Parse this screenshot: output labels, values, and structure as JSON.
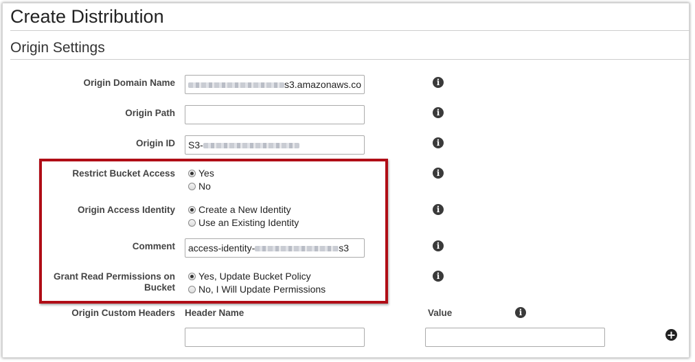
{
  "page": {
    "title": "Create Distribution"
  },
  "section": {
    "title": "Origin Settings"
  },
  "fields": {
    "origin_domain_name": {
      "label": "Origin Domain Name",
      "value_suffix": "s3.amazonaws.co"
    },
    "origin_path": {
      "label": "Origin Path",
      "value": ""
    },
    "origin_id": {
      "label": "Origin ID",
      "value_prefix": "S3-"
    },
    "restrict_bucket_access": {
      "label": "Restrict Bucket Access",
      "options": [
        {
          "label": "Yes",
          "checked": true
        },
        {
          "label": "No",
          "checked": false
        }
      ]
    },
    "origin_access_identity": {
      "label": "Origin Access Identity",
      "options": [
        {
          "label": "Create a New Identity",
          "checked": true
        },
        {
          "label": "Use an Existing Identity",
          "checked": false
        }
      ]
    },
    "comment": {
      "label": "Comment",
      "value_prefix": "access-identity-",
      "value_suffix": "s3"
    },
    "grant_read_permissions": {
      "label_line1": "Grant Read Permissions on",
      "label_line2": "Bucket",
      "options": [
        {
          "label": "Yes, Update Bucket Policy",
          "checked": true
        },
        {
          "label": "No, I Will Update Permissions",
          "checked": false
        }
      ]
    },
    "origin_custom_headers": {
      "label": "Origin Custom Headers",
      "header_name_label": "Header Name",
      "value_label": "Value",
      "header_name_value": "",
      "value_value": ""
    }
  },
  "icons": {
    "info": "info-icon",
    "add": "plus-circle-icon"
  },
  "colors": {
    "highlight_border": "#b00d16",
    "icon": "#3a3a3a"
  }
}
